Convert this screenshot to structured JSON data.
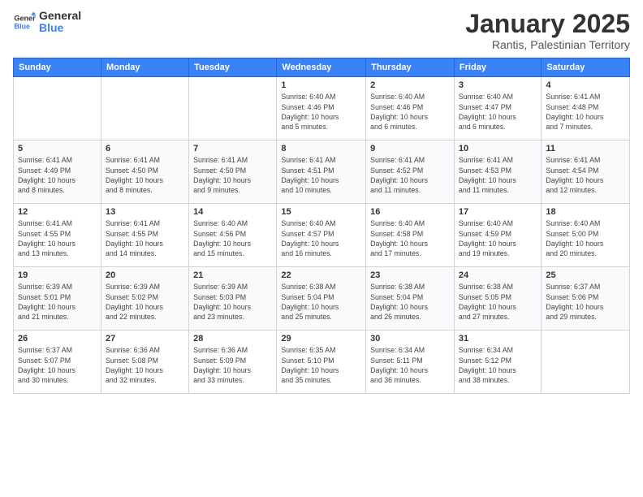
{
  "logo": {
    "general": "General",
    "blue": "Blue"
  },
  "header": {
    "month": "January 2025",
    "location": "Rantis, Palestinian Territory"
  },
  "weekdays": [
    "Sunday",
    "Monday",
    "Tuesday",
    "Wednesday",
    "Thursday",
    "Friday",
    "Saturday"
  ],
  "weeks": [
    [
      {
        "day": "",
        "info": ""
      },
      {
        "day": "",
        "info": ""
      },
      {
        "day": "",
        "info": ""
      },
      {
        "day": "1",
        "info": "Sunrise: 6:40 AM\nSunset: 4:46 PM\nDaylight: 10 hours\nand 5 minutes."
      },
      {
        "day": "2",
        "info": "Sunrise: 6:40 AM\nSunset: 4:46 PM\nDaylight: 10 hours\nand 6 minutes."
      },
      {
        "day": "3",
        "info": "Sunrise: 6:40 AM\nSunset: 4:47 PM\nDaylight: 10 hours\nand 6 minutes."
      },
      {
        "day": "4",
        "info": "Sunrise: 6:41 AM\nSunset: 4:48 PM\nDaylight: 10 hours\nand 7 minutes."
      }
    ],
    [
      {
        "day": "5",
        "info": "Sunrise: 6:41 AM\nSunset: 4:49 PM\nDaylight: 10 hours\nand 8 minutes."
      },
      {
        "day": "6",
        "info": "Sunrise: 6:41 AM\nSunset: 4:50 PM\nDaylight: 10 hours\nand 8 minutes."
      },
      {
        "day": "7",
        "info": "Sunrise: 6:41 AM\nSunset: 4:50 PM\nDaylight: 10 hours\nand 9 minutes."
      },
      {
        "day": "8",
        "info": "Sunrise: 6:41 AM\nSunset: 4:51 PM\nDaylight: 10 hours\nand 10 minutes."
      },
      {
        "day": "9",
        "info": "Sunrise: 6:41 AM\nSunset: 4:52 PM\nDaylight: 10 hours\nand 11 minutes."
      },
      {
        "day": "10",
        "info": "Sunrise: 6:41 AM\nSunset: 4:53 PM\nDaylight: 10 hours\nand 11 minutes."
      },
      {
        "day": "11",
        "info": "Sunrise: 6:41 AM\nSunset: 4:54 PM\nDaylight: 10 hours\nand 12 minutes."
      }
    ],
    [
      {
        "day": "12",
        "info": "Sunrise: 6:41 AM\nSunset: 4:55 PM\nDaylight: 10 hours\nand 13 minutes."
      },
      {
        "day": "13",
        "info": "Sunrise: 6:41 AM\nSunset: 4:55 PM\nDaylight: 10 hours\nand 14 minutes."
      },
      {
        "day": "14",
        "info": "Sunrise: 6:40 AM\nSunset: 4:56 PM\nDaylight: 10 hours\nand 15 minutes."
      },
      {
        "day": "15",
        "info": "Sunrise: 6:40 AM\nSunset: 4:57 PM\nDaylight: 10 hours\nand 16 minutes."
      },
      {
        "day": "16",
        "info": "Sunrise: 6:40 AM\nSunset: 4:58 PM\nDaylight: 10 hours\nand 17 minutes."
      },
      {
        "day": "17",
        "info": "Sunrise: 6:40 AM\nSunset: 4:59 PM\nDaylight: 10 hours\nand 19 minutes."
      },
      {
        "day": "18",
        "info": "Sunrise: 6:40 AM\nSunset: 5:00 PM\nDaylight: 10 hours\nand 20 minutes."
      }
    ],
    [
      {
        "day": "19",
        "info": "Sunrise: 6:39 AM\nSunset: 5:01 PM\nDaylight: 10 hours\nand 21 minutes."
      },
      {
        "day": "20",
        "info": "Sunrise: 6:39 AM\nSunset: 5:02 PM\nDaylight: 10 hours\nand 22 minutes."
      },
      {
        "day": "21",
        "info": "Sunrise: 6:39 AM\nSunset: 5:03 PM\nDaylight: 10 hours\nand 23 minutes."
      },
      {
        "day": "22",
        "info": "Sunrise: 6:38 AM\nSunset: 5:04 PM\nDaylight: 10 hours\nand 25 minutes."
      },
      {
        "day": "23",
        "info": "Sunrise: 6:38 AM\nSunset: 5:04 PM\nDaylight: 10 hours\nand 26 minutes."
      },
      {
        "day": "24",
        "info": "Sunrise: 6:38 AM\nSunset: 5:05 PM\nDaylight: 10 hours\nand 27 minutes."
      },
      {
        "day": "25",
        "info": "Sunrise: 6:37 AM\nSunset: 5:06 PM\nDaylight: 10 hours\nand 29 minutes."
      }
    ],
    [
      {
        "day": "26",
        "info": "Sunrise: 6:37 AM\nSunset: 5:07 PM\nDaylight: 10 hours\nand 30 minutes."
      },
      {
        "day": "27",
        "info": "Sunrise: 6:36 AM\nSunset: 5:08 PM\nDaylight: 10 hours\nand 32 minutes."
      },
      {
        "day": "28",
        "info": "Sunrise: 6:36 AM\nSunset: 5:09 PM\nDaylight: 10 hours\nand 33 minutes."
      },
      {
        "day": "29",
        "info": "Sunrise: 6:35 AM\nSunset: 5:10 PM\nDaylight: 10 hours\nand 35 minutes."
      },
      {
        "day": "30",
        "info": "Sunrise: 6:34 AM\nSunset: 5:11 PM\nDaylight: 10 hours\nand 36 minutes."
      },
      {
        "day": "31",
        "info": "Sunrise: 6:34 AM\nSunset: 5:12 PM\nDaylight: 10 hours\nand 38 minutes."
      },
      {
        "day": "",
        "info": ""
      }
    ]
  ]
}
